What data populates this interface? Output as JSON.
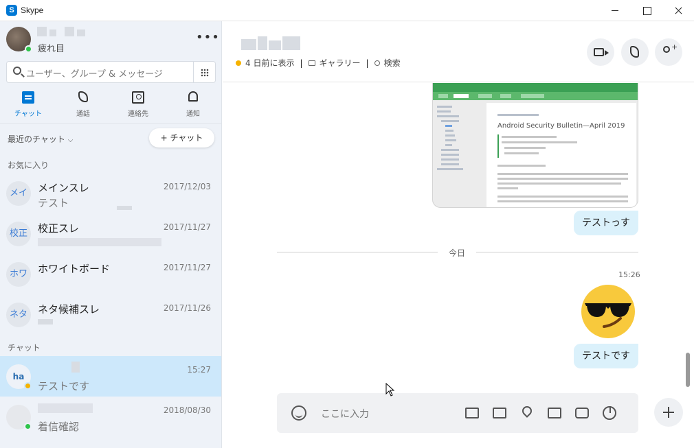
{
  "window": {
    "title": "Skype"
  },
  "profile": {
    "status_text": "疲れ目"
  },
  "search": {
    "placeholder": "ユーザー、グループ & メッセージ"
  },
  "nav": {
    "chat": "チャット",
    "calls": "通話",
    "contacts": "連絡先",
    "notifications": "通知"
  },
  "sidebar": {
    "recent_label": "最近のチャット",
    "new_chat_label": "+ チャット",
    "favorites_label": "お気に入り",
    "chats_label": "チャット",
    "favorites": [
      {
        "initials": "メイ",
        "name": "メインスレ",
        "preview": "テスト",
        "date": "2017/12/03"
      },
      {
        "initials": "校正",
        "name": "校正スレ",
        "preview": "",
        "date": "2017/11/27"
      },
      {
        "initials": "ホワ",
        "name": "ホワイトボード",
        "preview": "",
        "date": "2017/11/27"
      },
      {
        "initials": "ネタ",
        "name": "ネタ候補スレ",
        "preview": "",
        "date": "2017/11/26"
      }
    ],
    "chats": [
      {
        "initials": "ha",
        "name": "",
        "preview": "テストです",
        "date": "15:27",
        "presence": "away"
      },
      {
        "initials": "",
        "name": "",
        "preview": "着信確認",
        "date": "2018/08/30",
        "presence": "online"
      }
    ]
  },
  "header": {
    "last_seen": "4 日前に表示",
    "gallery": "ギャラリー",
    "search": "検索"
  },
  "messages": {
    "screenshot_title": "Android Security Bulletin—April 2019",
    "bubble_1": "テストっす",
    "day_divider": "今日",
    "time": "15:26",
    "emoji": "sunglasses-emoji",
    "bubble_2": "テストです"
  },
  "compose": {
    "placeholder": "ここに入力"
  },
  "colors": {
    "accent": "#0078d4",
    "bubble": "#dbf1fb",
    "sidebar": "#eef2f8",
    "active_row": "#cde8fb",
    "online": "#2ec44a",
    "away": "#f6b200"
  }
}
